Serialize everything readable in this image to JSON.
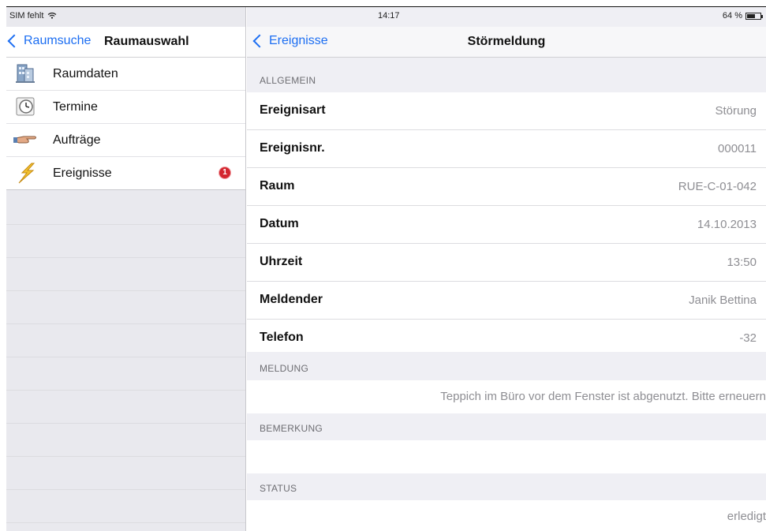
{
  "status_bar": {
    "carrier": "SIM fehlt",
    "time": "14:17",
    "battery": "64 %",
    "battery_level": 0.64
  },
  "sidebar": {
    "back_label": "Raumsuche",
    "title": "Raumauswahl",
    "items": [
      {
        "label": "Raumdaten",
        "icon": "building-icon"
      },
      {
        "label": "Termine",
        "icon": "clock-icon"
      },
      {
        "label": "Aufträge",
        "icon": "pointing-hand-icon"
      },
      {
        "label": "Ereignisse",
        "icon": "lightning-icon",
        "badge": "1"
      }
    ]
  },
  "detail": {
    "back_label": "Ereignisse",
    "title": "Störmeldung",
    "sections": {
      "allgemein": "ALLGEMEIN",
      "meldung": "MELDUNG",
      "bemerkung": "BEMERKUNG",
      "status": "STATUS"
    },
    "fields": [
      {
        "label": "Ereignisart",
        "value": "Störung"
      },
      {
        "label": "Ereignisnr.",
        "value": "000011"
      },
      {
        "label": "Raum",
        "value": "RUE-C-01-042"
      },
      {
        "label": "Datum",
        "value": "14.10.2013"
      },
      {
        "label": "Uhrzeit",
        "value": "13:50"
      },
      {
        "label": "Meldender",
        "value": "Janik Bettina"
      },
      {
        "label": "Telefon",
        "value": "-32"
      }
    ],
    "meldung_text": "Teppich im Büro vor dem Fenster ist abgenutzt. Bitte erneuern",
    "bemerkung_text": "",
    "status_text": "erledigt"
  },
  "colors": {
    "accent": "#1c6ef2",
    "badge": "#d3262f",
    "sidebar_bg": "#e9e9ee",
    "grouped_bg": "#efeff4"
  }
}
